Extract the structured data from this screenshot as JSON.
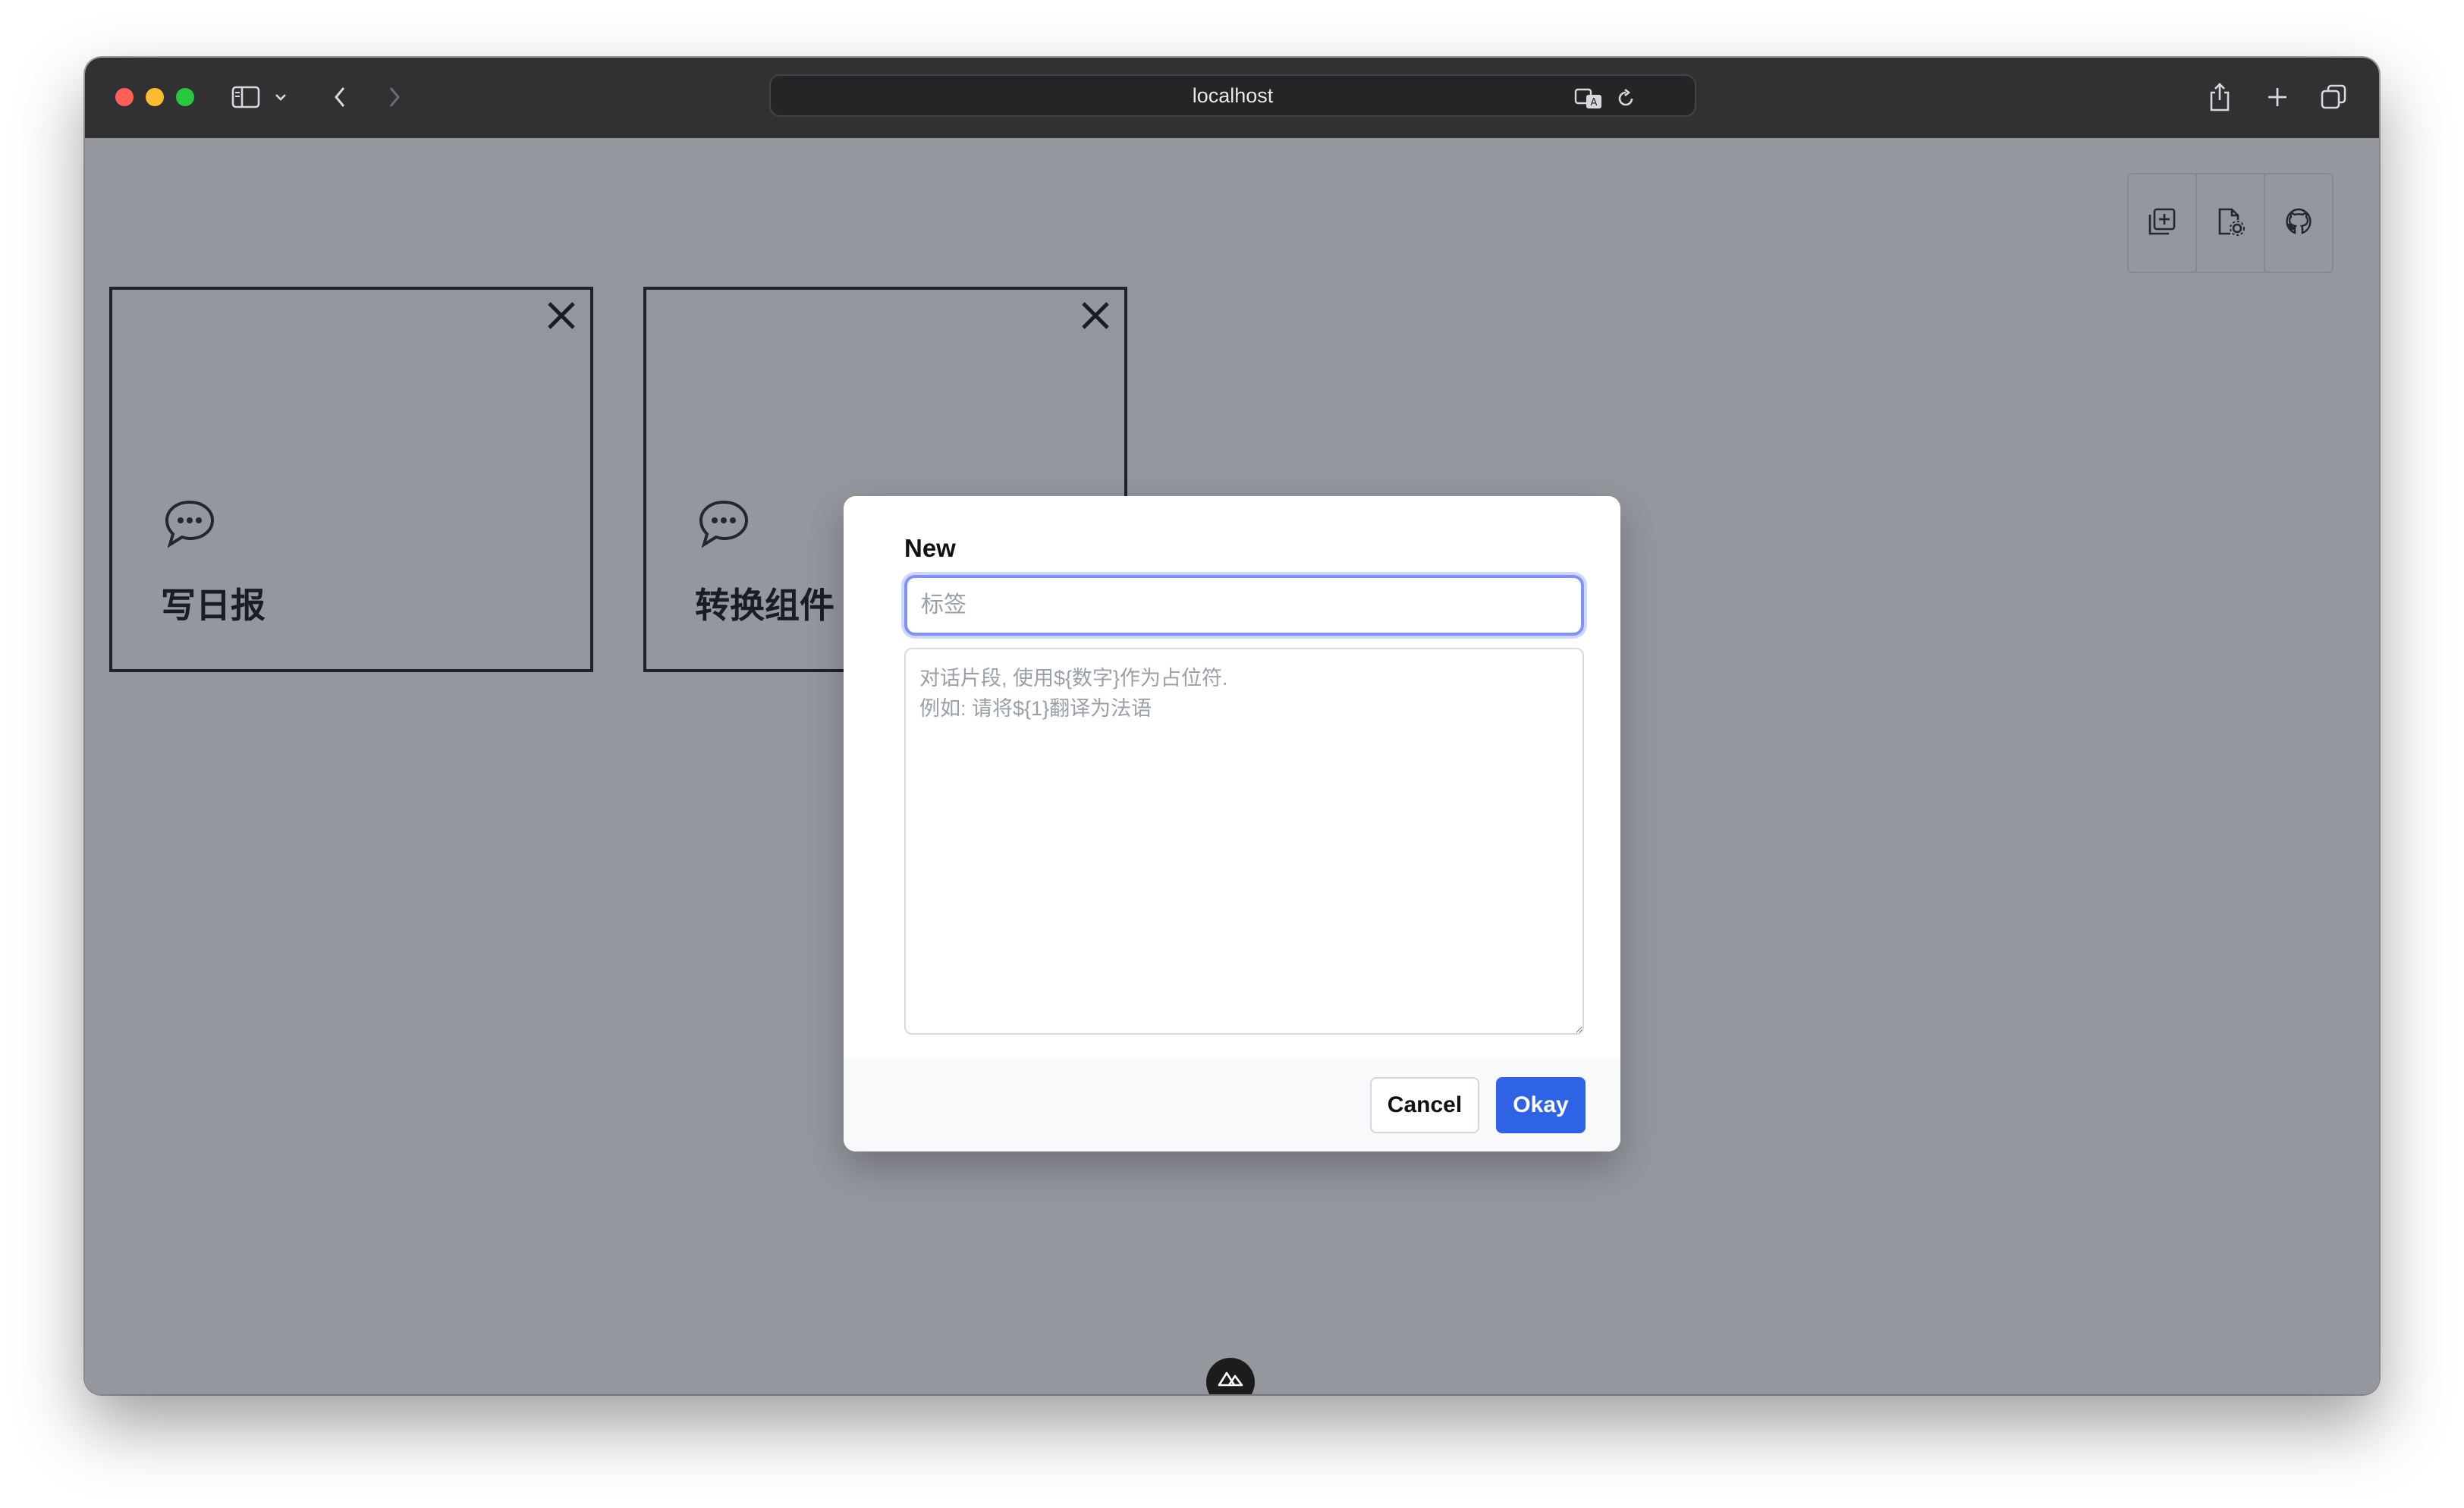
{
  "browser": {
    "url": "localhost",
    "icons": [
      "sidebar-icon",
      "chevron-down-icon",
      "back-icon",
      "forward-icon",
      "translate-icon",
      "reload-icon",
      "share-icon",
      "new-tab-icon",
      "tab-overview-icon"
    ]
  },
  "toolbar": {
    "icons": [
      "add-card-icon",
      "file-settings-icon",
      "github-icon"
    ]
  },
  "cards": [
    {
      "label": "写日报",
      "icon": "chat-bubble-icon"
    },
    {
      "label": "转换组件",
      "icon": "chat-bubble-icon"
    }
  ],
  "modal": {
    "title": "New",
    "tag_placeholder": "标签",
    "tag_value": "",
    "prompt_placeholder": "对话片段, 使用${数字}作为占位符.\n例如: 请将${1}翻译为法语",
    "prompt_value": "",
    "cancel_label": "Cancel",
    "okay_label": "Okay"
  },
  "colors": {
    "primary": "#2f63e6",
    "focus_ring": "#7f93f6",
    "overlay": "rgba(17,24,39,0.45)"
  }
}
